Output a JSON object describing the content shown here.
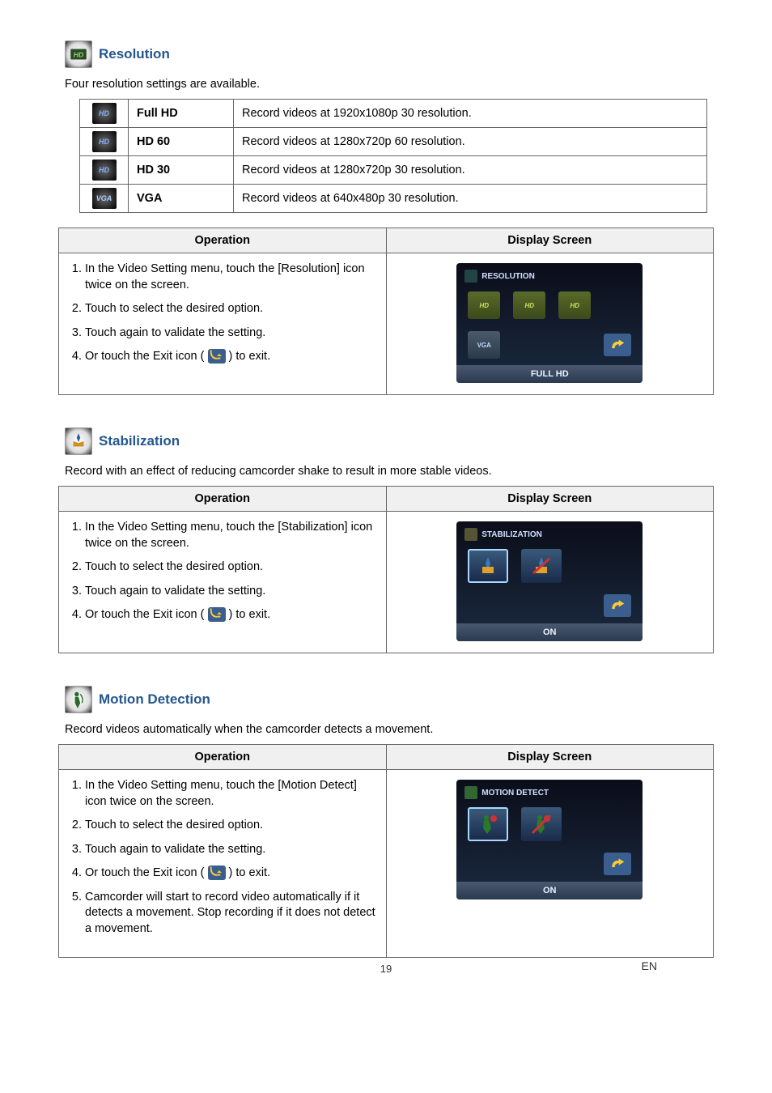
{
  "resolution": {
    "title": "Resolution",
    "intro": "Four resolution settings are available.",
    "rows": [
      {
        "name": "Full HD",
        "desc": "Record videos at 1920x1080p 30 resolution."
      },
      {
        "name": "HD 60",
        "desc": "Record videos at 1280x720p 60 resolution."
      },
      {
        "name": "HD 30",
        "desc": "Record videos at 1280x720p 30 resolution."
      },
      {
        "name": "VGA",
        "desc": "Record videos at 640x480p 30 resolution."
      }
    ],
    "op_head": "Operation",
    "ds_head": "Display Screen",
    "steps": {
      "s1": "In the Video Setting menu, touch the [Resolution] icon twice on the screen.",
      "s2": "Touch to select the desired option.",
      "s3": "Touch again to validate the setting.",
      "s4a": "Or touch the Exit icon (",
      "s4b": ") to exit."
    },
    "screen": {
      "head": "RESOLUTION",
      "hd": "HD",
      "vga": "VGA",
      "foot": "FULL HD"
    }
  },
  "stabilization": {
    "title": "Stabilization",
    "intro": "Record with an effect of reducing camcorder shake to result in more stable videos.",
    "op_head": "Operation",
    "ds_head": "Display Screen",
    "steps": {
      "s1": "In the Video Setting menu, touch the [Stabilization] icon twice on the screen.",
      "s2": "Touch to select the desired option.",
      "s3": "Touch again to validate the setting.",
      "s4a": "Or touch the Exit icon (",
      "s4b": ") to exit."
    },
    "screen": {
      "head": "STABILIZATION",
      "foot": "ON"
    }
  },
  "motion": {
    "title": "Motion Detection",
    "intro": "Record videos automatically when the camcorder detects a movement.",
    "op_head": "Operation",
    "ds_head": "Display Screen",
    "steps": {
      "s1": "In the Video Setting menu, touch the [Motion Detect] icon twice on the screen.",
      "s2": "Touch to select the desired option.",
      "s3": "Touch again to validate the setting.",
      "s4a": "Or touch the Exit icon (",
      "s4b": ") to exit.",
      "s5": "Camcorder will start to record video automatically if it detects a movement. Stop recording if it does not detect a movement."
    },
    "screen": {
      "head": "MOTION DETECT",
      "foot": "ON"
    }
  },
  "page": {
    "num": "19",
    "lang": "EN"
  }
}
